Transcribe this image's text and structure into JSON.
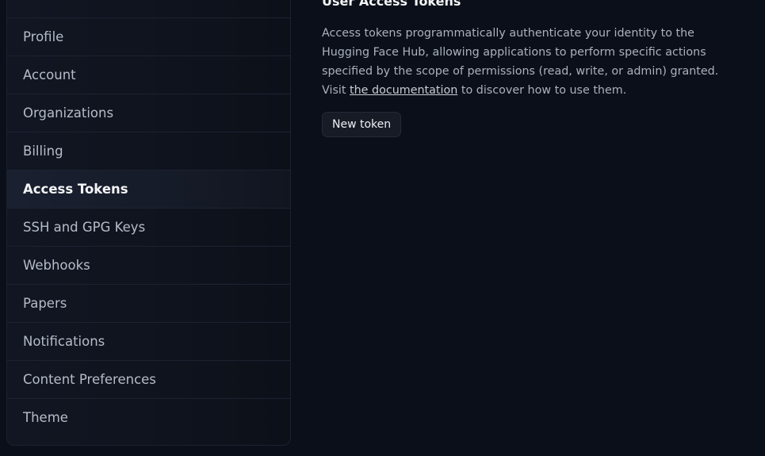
{
  "sidebar": {
    "items": [
      {
        "label": "Profile"
      },
      {
        "label": "Account"
      },
      {
        "label": "Organizations"
      },
      {
        "label": "Billing"
      },
      {
        "label": "Access Tokens"
      },
      {
        "label": "SSH and GPG Keys"
      },
      {
        "label": "Webhooks"
      },
      {
        "label": "Papers"
      },
      {
        "label": "Notifications"
      },
      {
        "label": "Content Preferences"
      },
      {
        "label": "Theme"
      }
    ],
    "active": "Access Tokens"
  },
  "main": {
    "title": "User Access Tokens",
    "description_part1": "Access tokens programmatically authenticate your identity to the Hugging Face Hub, allowing applications to perform specific actions specified by the scope of permissions (read, write, or admin) granted. Visit ",
    "doc_link": "the documentation",
    "description_part2": " to discover how to use them.",
    "new_token_label": "New token"
  }
}
